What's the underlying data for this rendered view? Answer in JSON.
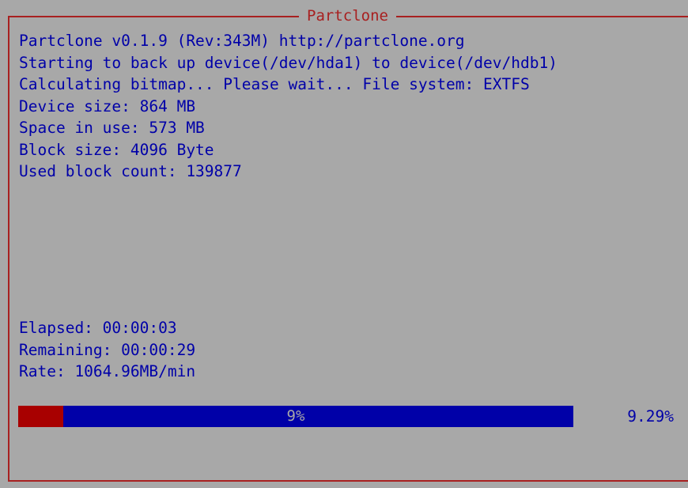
{
  "window": {
    "title": "Partclone"
  },
  "colors": {
    "background": "#a8a8a8",
    "text": "#0000a8",
    "frame": "#a82020",
    "progress_done": "#a80000",
    "progress_remaining": "#0000a8"
  },
  "log_lines": [
    "Partclone v0.1.9 (Rev:343M) http://partclone.org",
    "Starting to back up device(/dev/hda1) to device(/dev/hdb1)",
    "Calculating bitmap... Please wait... File system: EXTFS",
    "Device size: 864 MB",
    "Space in use: 573 MB",
    "Block size: 4096 Byte",
    "Used block count: 139877"
  ],
  "stats": {
    "elapsed": "Elapsed: 00:00:03",
    "remaining": "Remaining: 00:00:29",
    "rate": "Rate: 1064.96MB/min"
  },
  "progress": {
    "fraction": 0.0809,
    "label": "9%",
    "percent_text": "9.29%"
  }
}
